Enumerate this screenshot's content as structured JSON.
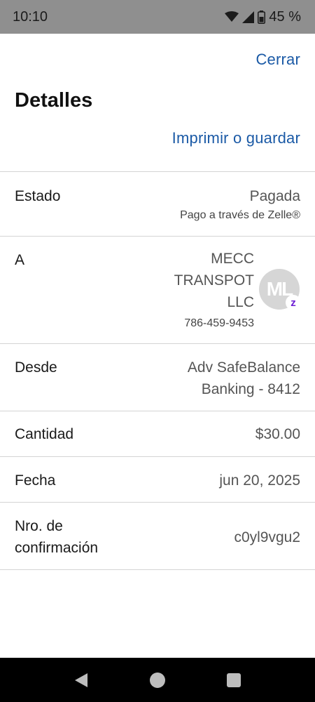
{
  "status_bar": {
    "time": "10:10",
    "battery": "45 %",
    "icons": [
      "wifi-icon",
      "signal-icon",
      "battery-icon"
    ]
  },
  "header": {
    "close_label": "Cerrar",
    "title": "Detalles",
    "print_label": "Imprimir o guardar"
  },
  "details": {
    "status": {
      "label": "Estado",
      "value": "Pagada",
      "sub": "Pago a través de Zelle®"
    },
    "to": {
      "label": "A",
      "name": "MECC\nTRANSPOT\nLLC",
      "phone": "786-459-9453",
      "avatar_initials": "ML",
      "badge": "z"
    },
    "from": {
      "label": "Desde",
      "value": "Adv SafeBalance\nBanking - 8412"
    },
    "amount": {
      "label": "Cantidad",
      "value": "$30.00"
    },
    "date": {
      "label": "Fecha",
      "value": "jun 20, 2025"
    },
    "confirmation": {
      "label": "Nro. de\nconfirmación",
      "value": "c0yl9vgu2"
    }
  },
  "colors": {
    "link": "#1b5aa6",
    "zelle": "#6d1ed4",
    "status_bar": "#8f8f8f"
  }
}
